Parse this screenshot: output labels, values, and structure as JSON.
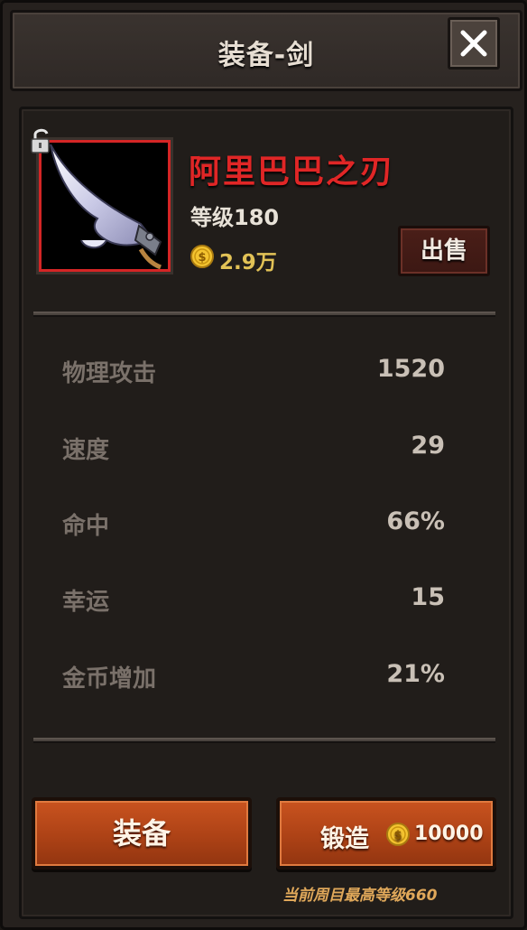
{
  "header": {
    "title": "装备-剑",
    "close_icon": "close-icon"
  },
  "item": {
    "name": "阿里巴巴之刃",
    "level": "等级180",
    "price": "2.9万",
    "lock_icon": "unlocked-padlock-icon",
    "image_icon": "curved-blade-icon",
    "name_color": "#e02626"
  },
  "sell_button": {
    "label": "出售"
  },
  "stats": [
    {
      "label": "物理攻击",
      "value": "1520"
    },
    {
      "label": "速度",
      "value": "29"
    },
    {
      "label": "命中",
      "value": "66%"
    },
    {
      "label": "幸运",
      "value": "15"
    },
    {
      "label": "金币增加",
      "value": "21%"
    }
  ],
  "actions": {
    "equip_label": "装备",
    "forge_label": "锻造",
    "forge_cost": "10000",
    "coin_icon": "gold-coin-icon"
  },
  "footer_note": "当前周目最高等级660"
}
